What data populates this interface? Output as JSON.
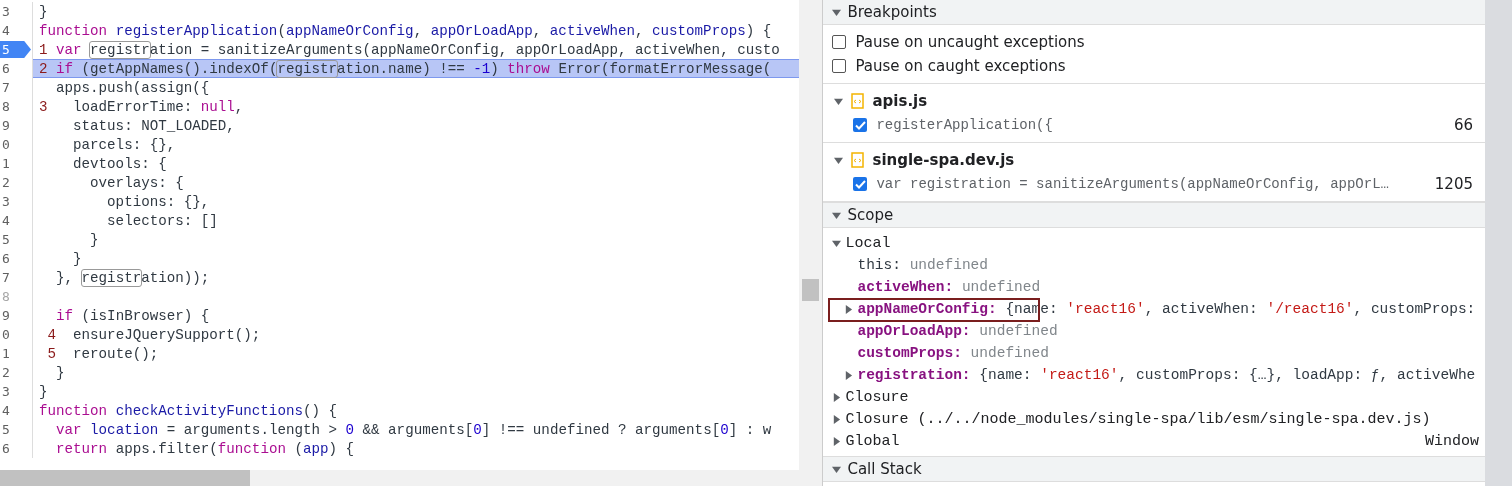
{
  "code": {
    "lines": [
      {
        "number": "3",
        "breakpoint": false,
        "paused": false,
        "muted": false,
        "tokens": [
          {
            "text": "}",
            "kind": "plain"
          }
        ]
      },
      {
        "number": "4",
        "breakpoint": false,
        "paused": false,
        "muted": false,
        "tokens": [
          {
            "text": "function ",
            "kind": "keyword"
          },
          {
            "text": "registerApplication",
            "kind": "name"
          },
          {
            "text": "(",
            "kind": "plain"
          },
          {
            "text": "appNameOrConfig",
            "kind": "name"
          },
          {
            "text": ", ",
            "kind": "plain"
          },
          {
            "text": "appOrLoadApp",
            "kind": "name"
          },
          {
            "text": ", ",
            "kind": "plain"
          },
          {
            "text": "activeWhen",
            "kind": "name"
          },
          {
            "text": ", ",
            "kind": "plain"
          },
          {
            "text": "customProps",
            "kind": "name"
          },
          {
            "text": ") {",
            "kind": "plain"
          }
        ]
      },
      {
        "number": "5",
        "breakpoint": true,
        "paused": false,
        "muted": false,
        "tokens": [
          {
            "text": "1",
            "kind": "mark"
          },
          {
            "text": " var ",
            "kind": "keyword"
          },
          {
            "text": "registr",
            "kind": "match"
          },
          {
            "text": "ation = sanitizeArguments(appNameOrConfig, appOrLoadApp, activeWhen, custo",
            "kind": "plain"
          }
        ]
      },
      {
        "number": "6",
        "breakpoint": false,
        "paused": true,
        "muted": false,
        "tokens": [
          {
            "text": "2",
            "kind": "mark"
          },
          {
            "text": " if",
            "kind": "keyword"
          },
          {
            "text": " (getAppNames().indexOf(",
            "kind": "plain"
          },
          {
            "text": "registr",
            "kind": "match"
          },
          {
            "text": "ation.name) !== ",
            "kind": "plain"
          },
          {
            "text": "-1",
            "kind": "number"
          },
          {
            "text": ") ",
            "kind": "plain"
          },
          {
            "text": "throw",
            "kind": "keyword"
          },
          {
            "text": " Error(formatErrorMessage(",
            "kind": "plain"
          }
        ]
      },
      {
        "number": "7",
        "breakpoint": false,
        "paused": false,
        "muted": false,
        "tokens": [
          {
            "text": "  apps.push(assign({",
            "kind": "plain"
          }
        ]
      },
      {
        "number": "8",
        "breakpoint": false,
        "paused": false,
        "muted": false,
        "tokens": [
          {
            "text": "3",
            "kind": "mark"
          },
          {
            "text": "   loadErrorTime: ",
            "kind": "plain"
          },
          {
            "text": "null",
            "kind": "keyword"
          },
          {
            "text": ",",
            "kind": "plain"
          }
        ]
      },
      {
        "number": "9",
        "breakpoint": false,
        "paused": false,
        "muted": false,
        "tokens": [
          {
            "text": "    status: NOT_LOADED,",
            "kind": "plain"
          }
        ]
      },
      {
        "number": "0",
        "breakpoint": false,
        "paused": false,
        "muted": false,
        "tokens": [
          {
            "text": "    parcels: {},",
            "kind": "plain"
          }
        ]
      },
      {
        "number": "1",
        "breakpoint": false,
        "paused": false,
        "muted": false,
        "tokens": [
          {
            "text": "    devtools: {",
            "kind": "plain"
          }
        ]
      },
      {
        "number": "2",
        "breakpoint": false,
        "paused": false,
        "muted": false,
        "tokens": [
          {
            "text": "      overlays: {",
            "kind": "plain"
          }
        ]
      },
      {
        "number": "3",
        "breakpoint": false,
        "paused": false,
        "muted": false,
        "tokens": [
          {
            "text": "        options: {},",
            "kind": "plain"
          }
        ]
      },
      {
        "number": "4",
        "breakpoint": false,
        "paused": false,
        "muted": false,
        "tokens": [
          {
            "text": "        selectors: []",
            "kind": "plain"
          }
        ]
      },
      {
        "number": "5",
        "breakpoint": false,
        "paused": false,
        "muted": false,
        "tokens": [
          {
            "text": "      }",
            "kind": "plain"
          }
        ]
      },
      {
        "number": "6",
        "breakpoint": false,
        "paused": false,
        "muted": false,
        "tokens": [
          {
            "text": "    }",
            "kind": "plain"
          }
        ]
      },
      {
        "number": "7",
        "breakpoint": false,
        "paused": false,
        "muted": false,
        "tokens": [
          {
            "text": "  }, ",
            "kind": "plain"
          },
          {
            "text": "registr",
            "kind": "match"
          },
          {
            "text": "ation));",
            "kind": "plain"
          }
        ]
      },
      {
        "number": "8",
        "breakpoint": false,
        "paused": false,
        "muted": true
      },
      {
        "number": "9",
        "breakpoint": false,
        "paused": false,
        "muted": false,
        "tokens": [
          {
            "text": "  if",
            "kind": "keyword"
          },
          {
            "text": " (isInBrowser) {",
            "kind": "plain"
          }
        ]
      },
      {
        "number": "0",
        "breakpoint": false,
        "paused": false,
        "muted": false,
        "tokens": [
          {
            "text": " 4",
            "kind": "mark"
          },
          {
            "text": "  ensureJQuerySupport();",
            "kind": "plain"
          }
        ]
      },
      {
        "number": "1",
        "breakpoint": false,
        "paused": false,
        "muted": false,
        "tokens": [
          {
            "text": " 5",
            "kind": "mark"
          },
          {
            "text": "  reroute();",
            "kind": "plain"
          }
        ]
      },
      {
        "number": "2",
        "breakpoint": false,
        "paused": false,
        "muted": false,
        "tokens": [
          {
            "text": "  }",
            "kind": "plain"
          }
        ]
      },
      {
        "number": "3",
        "breakpoint": false,
        "paused": false,
        "muted": false,
        "tokens": [
          {
            "text": "}",
            "kind": "plain"
          }
        ]
      },
      {
        "number": "4",
        "breakpoint": false,
        "paused": false,
        "muted": false,
        "tokens": [
          {
            "text": "function ",
            "kind": "keyword"
          },
          {
            "text": "checkActivityFunctions",
            "kind": "name"
          },
          {
            "text": "() {",
            "kind": "plain"
          }
        ]
      },
      {
        "number": "5",
        "breakpoint": false,
        "paused": false,
        "muted": false,
        "tokens": [
          {
            "text": "  var ",
            "kind": "keyword"
          },
          {
            "text": "location",
            "kind": "name"
          },
          {
            "text": " = arguments.length > ",
            "kind": "plain"
          },
          {
            "text": "0",
            "kind": "number"
          },
          {
            "text": " && arguments[",
            "kind": "plain"
          },
          {
            "text": "0",
            "kind": "number"
          },
          {
            "text": "] !== undefined ? arguments[",
            "kind": "plain"
          },
          {
            "text": "0",
            "kind": "number"
          },
          {
            "text": "] : w",
            "kind": "plain"
          }
        ]
      },
      {
        "number": "6",
        "breakpoint": false,
        "paused": false,
        "muted": false,
        "tokens": [
          {
            "text": "  return",
            "kind": "keyword"
          },
          {
            "text": " apps.filter(",
            "kind": "plain"
          },
          {
            "text": "function",
            "kind": "keyword"
          },
          {
            "text": " (",
            "kind": "plain"
          },
          {
            "text": "app",
            "kind": "name"
          },
          {
            "text": ") {",
            "kind": "plain"
          }
        ]
      }
    ]
  },
  "breakpoints": {
    "title": "Breakpoints",
    "expanded": true,
    "options": [
      {
        "label": "Pause on uncaught exceptions",
        "checked": false
      },
      {
        "label": "Pause on caught exceptions",
        "checked": false
      }
    ],
    "files": [
      {
        "name": "apis.js",
        "expanded": true,
        "items": [
          {
            "code": "registerApplication({",
            "line": "66",
            "checked": true
          }
        ]
      },
      {
        "name": "single-spa.dev.js",
        "expanded": true,
        "items": [
          {
            "code": "var registration = sanitizeArguments(appNameOrConfig, appOrL…",
            "line": "1205",
            "checked": true
          }
        ]
      }
    ]
  },
  "scope": {
    "title": "Scope",
    "expanded": true,
    "groups": [
      {
        "label": "Local",
        "expanded": true,
        "variables": [
          {
            "name": "this:",
            "emphasized": false,
            "expandable": false,
            "annotated": false,
            "value": [
              {
                "text": "undefined",
                "kind": "undefined"
              }
            ]
          },
          {
            "name": "activeWhen:",
            "emphasized": true,
            "expandable": false,
            "annotated": false,
            "value": [
              {
                "text": "undefined",
                "kind": "undefined"
              }
            ]
          },
          {
            "name": "appNameOrConfig:",
            "emphasized": true,
            "expandable": true,
            "annotated": true,
            "value": [
              {
                "text": "{name: ",
                "kind": "plain"
              },
              {
                "text": "'react16'",
                "kind": "string"
              },
              {
                "text": ", activeWhen: ",
                "kind": "plain"
              },
              {
                "text": "'/react16'",
                "kind": "string"
              },
              {
                "text": ", customProps:",
                "kind": "plain"
              }
            ]
          },
          {
            "name": "appOrLoadApp:",
            "emphasized": true,
            "expandable": false,
            "annotated": false,
            "value": [
              {
                "text": "undefined",
                "kind": "undefined"
              }
            ]
          },
          {
            "name": "customProps:",
            "emphasized": true,
            "expandable": false,
            "annotated": false,
            "value": [
              {
                "text": "undefined",
                "kind": "undefined"
              }
            ]
          },
          {
            "name": "registration:",
            "emphasized": true,
            "expandable": true,
            "annotated": false,
            "value": [
              {
                "text": "{name: ",
                "kind": "plain"
              },
              {
                "text": "'react16'",
                "kind": "string"
              },
              {
                "text": ", customProps: {…}, loadApp: ƒ, activeWhe",
                "kind": "plain"
              }
            ]
          }
        ]
      },
      {
        "label": "Closure",
        "expanded": false
      },
      {
        "label": "Closure (../../node_modules/single-spa/lib/esm/single-spa.dev.js)",
        "expanded": false
      },
      {
        "label": "Global",
        "expanded": false,
        "value": "Window"
      }
    ]
  },
  "call_stack": {
    "title": "Call Stack",
    "expanded": true
  }
}
